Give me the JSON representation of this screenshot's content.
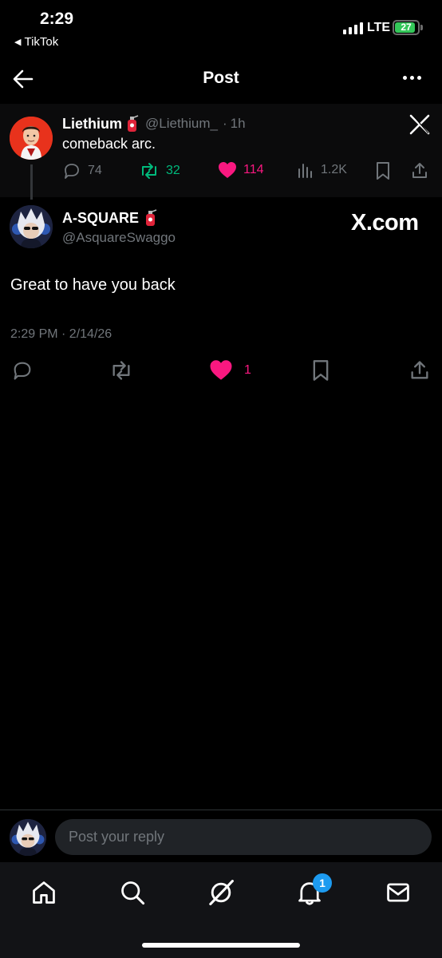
{
  "status_bar": {
    "time": "2:29",
    "back_app": "TikTok",
    "network": "LTE",
    "battery": "27",
    "battery_level": 0.27
  },
  "header": {
    "title": "Post"
  },
  "quoted_post": {
    "name": "Liethium",
    "handle": "@Liethium_",
    "separator": "·",
    "age": "1h",
    "text": "comeback arc.",
    "replies": "74",
    "reposts": "32",
    "likes": "114",
    "views": "1.2K"
  },
  "main_post": {
    "name": "A-SQUARE",
    "handle": "@AsquareSwaggo",
    "watermark": "X.com",
    "text": "Great to have you back",
    "timestamp": "2:29 PM · 2/14/26",
    "likes": "1"
  },
  "reply": {
    "placeholder": "Post your reply"
  },
  "bottom_nav": {
    "notification_count": "1"
  },
  "colors": {
    "background": "#000000",
    "muted": "#71767b",
    "repost_green": "#00ba7c",
    "like_pink": "#f91880",
    "accent_blue": "#1d9bf0"
  },
  "icons": [
    "back-arrow-icon",
    "more-icon",
    "x-logo-icon",
    "reply-icon",
    "repost-icon",
    "heart-icon",
    "views-icon",
    "bookmark-icon",
    "share-icon",
    "home-icon",
    "search-icon",
    "grok-icon",
    "bell-icon",
    "mail-icon"
  ]
}
